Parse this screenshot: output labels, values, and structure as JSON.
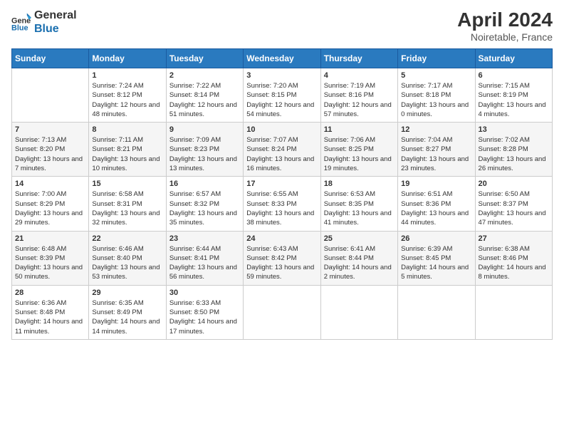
{
  "logo": {
    "line1": "General",
    "line2": "Blue"
  },
  "title": "April 2024",
  "subtitle": "Noiretable, France",
  "days_header": [
    "Sunday",
    "Monday",
    "Tuesday",
    "Wednesday",
    "Thursday",
    "Friday",
    "Saturday"
  ],
  "weeks": [
    [
      {
        "day": "",
        "sunrise": "",
        "sunset": "",
        "daylight": ""
      },
      {
        "day": "1",
        "sunrise": "Sunrise: 7:24 AM",
        "sunset": "Sunset: 8:12 PM",
        "daylight": "Daylight: 12 hours and 48 minutes."
      },
      {
        "day": "2",
        "sunrise": "Sunrise: 7:22 AM",
        "sunset": "Sunset: 8:14 PM",
        "daylight": "Daylight: 12 hours and 51 minutes."
      },
      {
        "day": "3",
        "sunrise": "Sunrise: 7:20 AM",
        "sunset": "Sunset: 8:15 PM",
        "daylight": "Daylight: 12 hours and 54 minutes."
      },
      {
        "day": "4",
        "sunrise": "Sunrise: 7:19 AM",
        "sunset": "Sunset: 8:16 PM",
        "daylight": "Daylight: 12 hours and 57 minutes."
      },
      {
        "day": "5",
        "sunrise": "Sunrise: 7:17 AM",
        "sunset": "Sunset: 8:18 PM",
        "daylight": "Daylight: 13 hours and 0 minutes."
      },
      {
        "day": "6",
        "sunrise": "Sunrise: 7:15 AM",
        "sunset": "Sunset: 8:19 PM",
        "daylight": "Daylight: 13 hours and 4 minutes."
      }
    ],
    [
      {
        "day": "7",
        "sunrise": "Sunrise: 7:13 AM",
        "sunset": "Sunset: 8:20 PM",
        "daylight": "Daylight: 13 hours and 7 minutes."
      },
      {
        "day": "8",
        "sunrise": "Sunrise: 7:11 AM",
        "sunset": "Sunset: 8:21 PM",
        "daylight": "Daylight: 13 hours and 10 minutes."
      },
      {
        "day": "9",
        "sunrise": "Sunrise: 7:09 AM",
        "sunset": "Sunset: 8:23 PM",
        "daylight": "Daylight: 13 hours and 13 minutes."
      },
      {
        "day": "10",
        "sunrise": "Sunrise: 7:07 AM",
        "sunset": "Sunset: 8:24 PM",
        "daylight": "Daylight: 13 hours and 16 minutes."
      },
      {
        "day": "11",
        "sunrise": "Sunrise: 7:06 AM",
        "sunset": "Sunset: 8:25 PM",
        "daylight": "Daylight: 13 hours and 19 minutes."
      },
      {
        "day": "12",
        "sunrise": "Sunrise: 7:04 AM",
        "sunset": "Sunset: 8:27 PM",
        "daylight": "Daylight: 13 hours and 23 minutes."
      },
      {
        "day": "13",
        "sunrise": "Sunrise: 7:02 AM",
        "sunset": "Sunset: 8:28 PM",
        "daylight": "Daylight: 13 hours and 26 minutes."
      }
    ],
    [
      {
        "day": "14",
        "sunrise": "Sunrise: 7:00 AM",
        "sunset": "Sunset: 8:29 PM",
        "daylight": "Daylight: 13 hours and 29 minutes."
      },
      {
        "day": "15",
        "sunrise": "Sunrise: 6:58 AM",
        "sunset": "Sunset: 8:31 PM",
        "daylight": "Daylight: 13 hours and 32 minutes."
      },
      {
        "day": "16",
        "sunrise": "Sunrise: 6:57 AM",
        "sunset": "Sunset: 8:32 PM",
        "daylight": "Daylight: 13 hours and 35 minutes."
      },
      {
        "day": "17",
        "sunrise": "Sunrise: 6:55 AM",
        "sunset": "Sunset: 8:33 PM",
        "daylight": "Daylight: 13 hours and 38 minutes."
      },
      {
        "day": "18",
        "sunrise": "Sunrise: 6:53 AM",
        "sunset": "Sunset: 8:35 PM",
        "daylight": "Daylight: 13 hours and 41 minutes."
      },
      {
        "day": "19",
        "sunrise": "Sunrise: 6:51 AM",
        "sunset": "Sunset: 8:36 PM",
        "daylight": "Daylight: 13 hours and 44 minutes."
      },
      {
        "day": "20",
        "sunrise": "Sunrise: 6:50 AM",
        "sunset": "Sunset: 8:37 PM",
        "daylight": "Daylight: 13 hours and 47 minutes."
      }
    ],
    [
      {
        "day": "21",
        "sunrise": "Sunrise: 6:48 AM",
        "sunset": "Sunset: 8:39 PM",
        "daylight": "Daylight: 13 hours and 50 minutes."
      },
      {
        "day": "22",
        "sunrise": "Sunrise: 6:46 AM",
        "sunset": "Sunset: 8:40 PM",
        "daylight": "Daylight: 13 hours and 53 minutes."
      },
      {
        "day": "23",
        "sunrise": "Sunrise: 6:44 AM",
        "sunset": "Sunset: 8:41 PM",
        "daylight": "Daylight: 13 hours and 56 minutes."
      },
      {
        "day": "24",
        "sunrise": "Sunrise: 6:43 AM",
        "sunset": "Sunset: 8:42 PM",
        "daylight": "Daylight: 13 hours and 59 minutes."
      },
      {
        "day": "25",
        "sunrise": "Sunrise: 6:41 AM",
        "sunset": "Sunset: 8:44 PM",
        "daylight": "Daylight: 14 hours and 2 minutes."
      },
      {
        "day": "26",
        "sunrise": "Sunrise: 6:39 AM",
        "sunset": "Sunset: 8:45 PM",
        "daylight": "Daylight: 14 hours and 5 minutes."
      },
      {
        "day": "27",
        "sunrise": "Sunrise: 6:38 AM",
        "sunset": "Sunset: 8:46 PM",
        "daylight": "Daylight: 14 hours and 8 minutes."
      }
    ],
    [
      {
        "day": "28",
        "sunrise": "Sunrise: 6:36 AM",
        "sunset": "Sunset: 8:48 PM",
        "daylight": "Daylight: 14 hours and 11 minutes."
      },
      {
        "day": "29",
        "sunrise": "Sunrise: 6:35 AM",
        "sunset": "Sunset: 8:49 PM",
        "daylight": "Daylight: 14 hours and 14 minutes."
      },
      {
        "day": "30",
        "sunrise": "Sunrise: 6:33 AM",
        "sunset": "Sunset: 8:50 PM",
        "daylight": "Daylight: 14 hours and 17 minutes."
      },
      {
        "day": "",
        "sunrise": "",
        "sunset": "",
        "daylight": ""
      },
      {
        "day": "",
        "sunrise": "",
        "sunset": "",
        "daylight": ""
      },
      {
        "day": "",
        "sunrise": "",
        "sunset": "",
        "daylight": ""
      },
      {
        "day": "",
        "sunrise": "",
        "sunset": "",
        "daylight": ""
      }
    ]
  ]
}
